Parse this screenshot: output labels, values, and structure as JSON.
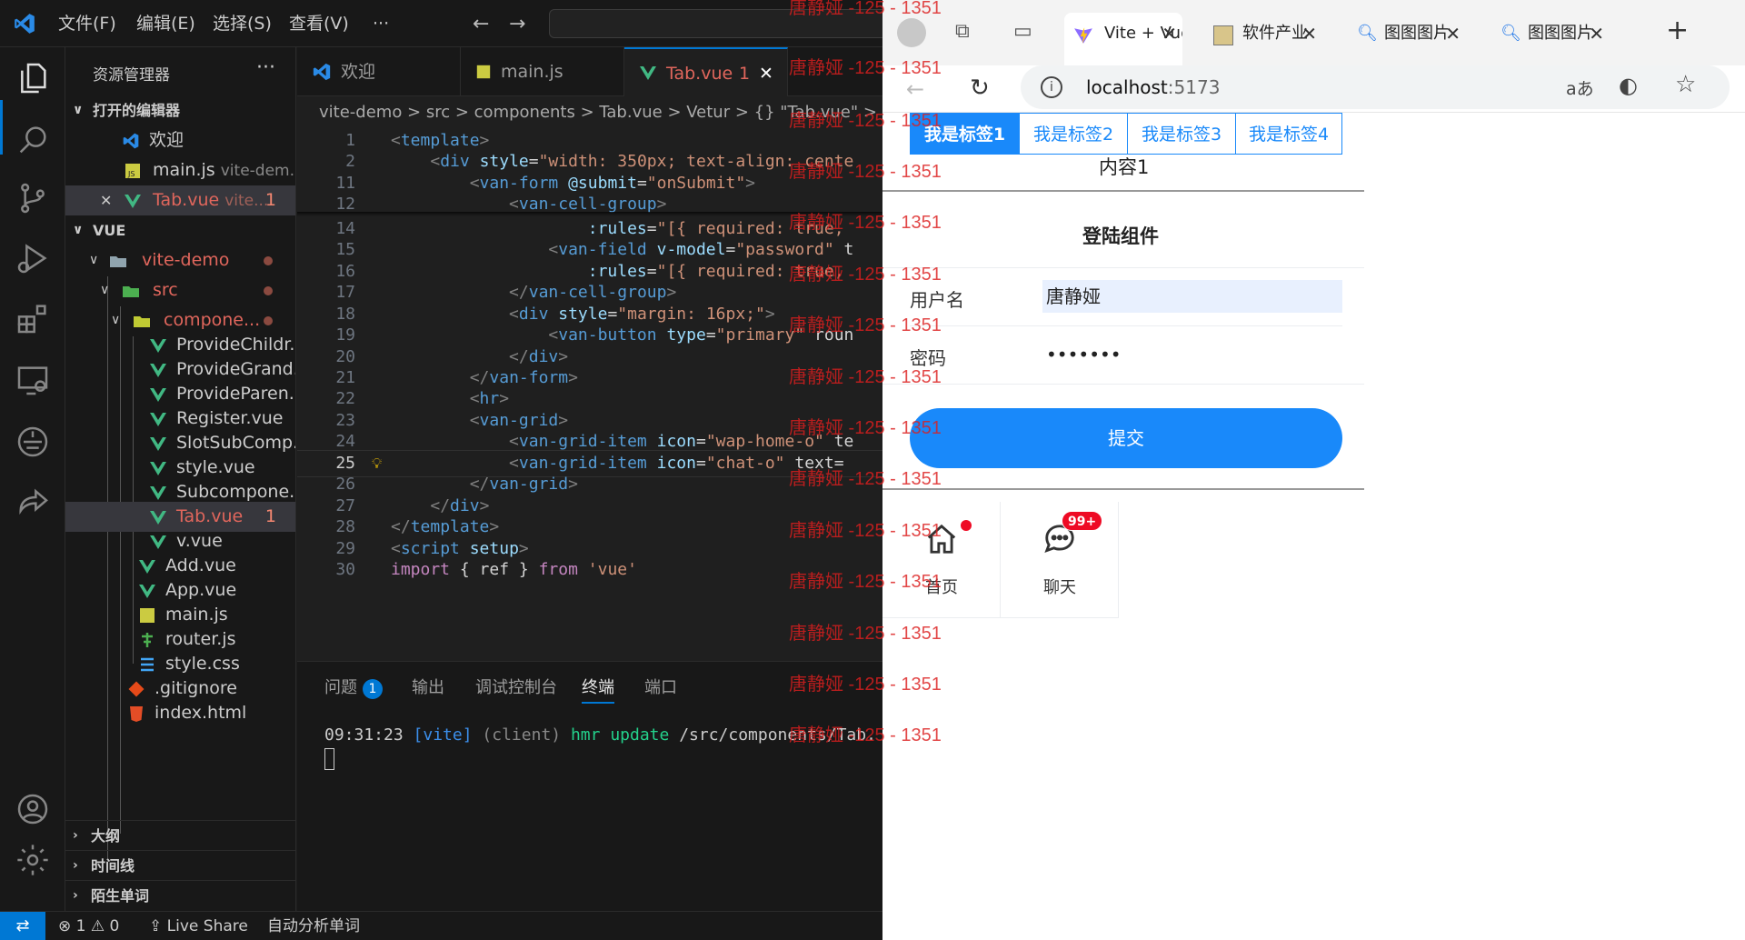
{
  "vscode": {
    "menu": [
      "文件(F)",
      "编辑(E)",
      "选择(S)",
      "查看(V)",
      "···"
    ],
    "explorer_title": "资源管理器",
    "explorer_more": "···",
    "open_editors_header": "打开的编辑器",
    "open_editors": [
      {
        "name": "欢迎",
        "sub": ""
      },
      {
        "name": "main.js",
        "sub": "vite-dem..."
      },
      {
        "name": "Tab.vue",
        "sub": "vite...",
        "badge": "1"
      }
    ],
    "folder_header": "VUE",
    "tree": [
      {
        "name": "vite-demo"
      },
      {
        "name": "src"
      },
      {
        "name": "compone..."
      },
      {
        "name": "ProvideChildr..."
      },
      {
        "name": "ProvideGrand..."
      },
      {
        "name": "ProvideParen..."
      },
      {
        "name": "Register.vue"
      },
      {
        "name": "SlotSubComp..."
      },
      {
        "name": "style.vue"
      },
      {
        "name": "Subcompone..."
      },
      {
        "name": "Tab.vue",
        "badge": "1"
      },
      {
        "name": "v.vue"
      },
      {
        "name": "Add.vue"
      },
      {
        "name": "App.vue"
      },
      {
        "name": "main.js"
      },
      {
        "name": "router.js"
      },
      {
        "name": "style.css"
      },
      {
        "name": ".gitignore"
      },
      {
        "name": "index.html"
      }
    ],
    "collapsed_sections": [
      "大纲",
      "时间线",
      "陌生单词"
    ],
    "tabs": [
      {
        "label": "欢迎"
      },
      {
        "label": "main.js"
      },
      {
        "label": "Tab.vue",
        "badge": "1",
        "close": "✕"
      }
    ],
    "breadcrumb": "vite-demo > src > components > Tab.vue > Vetur > {} \"Tab.vue\" >",
    "code": [
      {
        "ln": "1",
        "t": "<template>"
      },
      {
        "ln": "2",
        "t": "    <div style=\"width: 350px; text-align: cente"
      },
      {
        "ln": "11",
        "t": "        <van-form @submit=\"onSubmit\">"
      },
      {
        "ln": "12",
        "t": "            <van-cell-group>"
      },
      {
        "ln": "14",
        "t": "                    :rules=\"[{ required: true,"
      },
      {
        "ln": "15",
        "t": "                <van-field v-model=\"password\" t"
      },
      {
        "ln": "16",
        "t": "                    :rules=\"[{ required: true,"
      },
      {
        "ln": "17",
        "t": "            </van-cell-group>"
      },
      {
        "ln": "18",
        "t": "            <div style=\"margin: 16px;\">"
      },
      {
        "ln": "19",
        "t": "                <van-button type=\"primary\" roun"
      },
      {
        "ln": "20",
        "t": "            </div>"
      },
      {
        "ln": "21",
        "t": "        </van-form>"
      },
      {
        "ln": "22",
        "t": "        <hr>"
      },
      {
        "ln": "23",
        "t": "        <van-grid>"
      },
      {
        "ln": "24",
        "t": "            <van-grid-item icon=\"wap-home-o\" te"
      },
      {
        "ln": "25",
        "t": "            <van-grid-item icon=\"chat-o\" text="
      },
      {
        "ln": "26",
        "t": "        </van-grid>"
      },
      {
        "ln": "27",
        "t": "    </div>"
      },
      {
        "ln": "28",
        "t": "</template>"
      },
      {
        "ln": "29",
        "t": "<script setup>"
      },
      {
        "ln": "30",
        "t": "import { ref } from 'vue'"
      }
    ],
    "panel_tabs": [
      "问题",
      "输出",
      "调试控制台",
      "终端",
      "端口"
    ],
    "problems_count": "1",
    "terminal_time": "09:31:23",
    "terminal_tag": "[vite]",
    "terminal_client": "(client)",
    "terminal_hmr": "hmr update",
    "terminal_path": "/src/components/Tab.",
    "status": {
      "errors": "1",
      "warnings": "0",
      "live_share": "Live Share",
      "ext": "自动分析单词"
    }
  },
  "browser": {
    "tabs": [
      {
        "label": "Vite + Vue",
        "active": true
      },
      {
        "label": "软件产业"
      },
      {
        "label": "图图图片"
      },
      {
        "label": "图图图片"
      }
    ],
    "new_tab": "+",
    "url_host": "localhost",
    "url_port": ":5173",
    "translate": "aあ"
  },
  "page": {
    "tabs": [
      "我是标签1",
      "我是标签2",
      "我是标签3",
      "我是标签4"
    ],
    "content": "内容1",
    "form_title": "登陆组件",
    "username_label": "用户名",
    "username_value": "唐静娅",
    "password_label": "密码",
    "password_value": "•••••••",
    "submit_label": "提交",
    "grid": [
      {
        "label": "首页",
        "icon": "home-icon"
      },
      {
        "label": "聊天",
        "icon": "chat-icon",
        "badge": "99+"
      }
    ]
  },
  "watermark": "唐静娅 -125 - 1351"
}
